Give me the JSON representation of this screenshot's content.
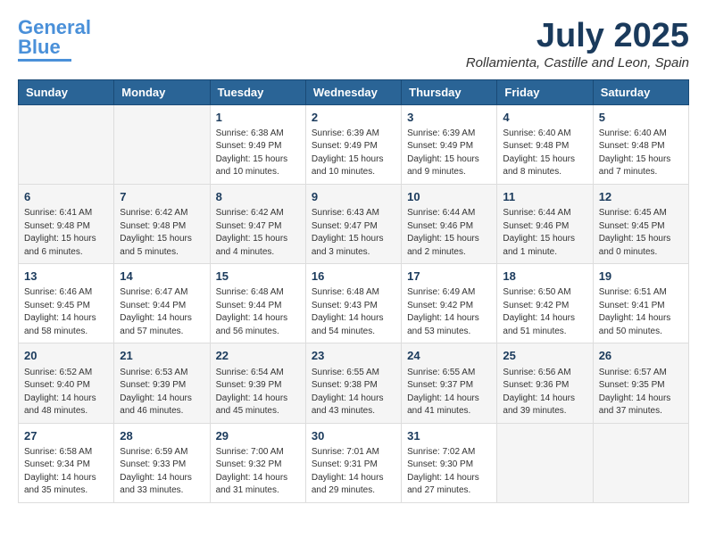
{
  "header": {
    "logo_line1": "General",
    "logo_line2": "Blue",
    "month": "July 2025",
    "location": "Rollamienta, Castille and Leon, Spain"
  },
  "days_of_week": [
    "Sunday",
    "Monday",
    "Tuesday",
    "Wednesday",
    "Thursday",
    "Friday",
    "Saturday"
  ],
  "weeks": [
    [
      {
        "day": "",
        "sunrise": "",
        "sunset": "",
        "daylight": ""
      },
      {
        "day": "",
        "sunrise": "",
        "sunset": "",
        "daylight": ""
      },
      {
        "day": "1",
        "sunrise": "Sunrise: 6:38 AM",
        "sunset": "Sunset: 9:49 PM",
        "daylight": "Daylight: 15 hours and 10 minutes."
      },
      {
        "day": "2",
        "sunrise": "Sunrise: 6:39 AM",
        "sunset": "Sunset: 9:49 PM",
        "daylight": "Daylight: 15 hours and 10 minutes."
      },
      {
        "day": "3",
        "sunrise": "Sunrise: 6:39 AM",
        "sunset": "Sunset: 9:49 PM",
        "daylight": "Daylight: 15 hours and 9 minutes."
      },
      {
        "day": "4",
        "sunrise": "Sunrise: 6:40 AM",
        "sunset": "Sunset: 9:48 PM",
        "daylight": "Daylight: 15 hours and 8 minutes."
      },
      {
        "day": "5",
        "sunrise": "Sunrise: 6:40 AM",
        "sunset": "Sunset: 9:48 PM",
        "daylight": "Daylight: 15 hours and 7 minutes."
      }
    ],
    [
      {
        "day": "6",
        "sunrise": "Sunrise: 6:41 AM",
        "sunset": "Sunset: 9:48 PM",
        "daylight": "Daylight: 15 hours and 6 minutes."
      },
      {
        "day": "7",
        "sunrise": "Sunrise: 6:42 AM",
        "sunset": "Sunset: 9:48 PM",
        "daylight": "Daylight: 15 hours and 5 minutes."
      },
      {
        "day": "8",
        "sunrise": "Sunrise: 6:42 AM",
        "sunset": "Sunset: 9:47 PM",
        "daylight": "Daylight: 15 hours and 4 minutes."
      },
      {
        "day": "9",
        "sunrise": "Sunrise: 6:43 AM",
        "sunset": "Sunset: 9:47 PM",
        "daylight": "Daylight: 15 hours and 3 minutes."
      },
      {
        "day": "10",
        "sunrise": "Sunrise: 6:44 AM",
        "sunset": "Sunset: 9:46 PM",
        "daylight": "Daylight: 15 hours and 2 minutes."
      },
      {
        "day": "11",
        "sunrise": "Sunrise: 6:44 AM",
        "sunset": "Sunset: 9:46 PM",
        "daylight": "Daylight: 15 hours and 1 minute."
      },
      {
        "day": "12",
        "sunrise": "Sunrise: 6:45 AM",
        "sunset": "Sunset: 9:45 PM",
        "daylight": "Daylight: 15 hours and 0 minutes."
      }
    ],
    [
      {
        "day": "13",
        "sunrise": "Sunrise: 6:46 AM",
        "sunset": "Sunset: 9:45 PM",
        "daylight": "Daylight: 14 hours and 58 minutes."
      },
      {
        "day": "14",
        "sunrise": "Sunrise: 6:47 AM",
        "sunset": "Sunset: 9:44 PM",
        "daylight": "Daylight: 14 hours and 57 minutes."
      },
      {
        "day": "15",
        "sunrise": "Sunrise: 6:48 AM",
        "sunset": "Sunset: 9:44 PM",
        "daylight": "Daylight: 14 hours and 56 minutes."
      },
      {
        "day": "16",
        "sunrise": "Sunrise: 6:48 AM",
        "sunset": "Sunset: 9:43 PM",
        "daylight": "Daylight: 14 hours and 54 minutes."
      },
      {
        "day": "17",
        "sunrise": "Sunrise: 6:49 AM",
        "sunset": "Sunset: 9:42 PM",
        "daylight": "Daylight: 14 hours and 53 minutes."
      },
      {
        "day": "18",
        "sunrise": "Sunrise: 6:50 AM",
        "sunset": "Sunset: 9:42 PM",
        "daylight": "Daylight: 14 hours and 51 minutes."
      },
      {
        "day": "19",
        "sunrise": "Sunrise: 6:51 AM",
        "sunset": "Sunset: 9:41 PM",
        "daylight": "Daylight: 14 hours and 50 minutes."
      }
    ],
    [
      {
        "day": "20",
        "sunrise": "Sunrise: 6:52 AM",
        "sunset": "Sunset: 9:40 PM",
        "daylight": "Daylight: 14 hours and 48 minutes."
      },
      {
        "day": "21",
        "sunrise": "Sunrise: 6:53 AM",
        "sunset": "Sunset: 9:39 PM",
        "daylight": "Daylight: 14 hours and 46 minutes."
      },
      {
        "day": "22",
        "sunrise": "Sunrise: 6:54 AM",
        "sunset": "Sunset: 9:39 PM",
        "daylight": "Daylight: 14 hours and 45 minutes."
      },
      {
        "day": "23",
        "sunrise": "Sunrise: 6:55 AM",
        "sunset": "Sunset: 9:38 PM",
        "daylight": "Daylight: 14 hours and 43 minutes."
      },
      {
        "day": "24",
        "sunrise": "Sunrise: 6:55 AM",
        "sunset": "Sunset: 9:37 PM",
        "daylight": "Daylight: 14 hours and 41 minutes."
      },
      {
        "day": "25",
        "sunrise": "Sunrise: 6:56 AM",
        "sunset": "Sunset: 9:36 PM",
        "daylight": "Daylight: 14 hours and 39 minutes."
      },
      {
        "day": "26",
        "sunrise": "Sunrise: 6:57 AM",
        "sunset": "Sunset: 9:35 PM",
        "daylight": "Daylight: 14 hours and 37 minutes."
      }
    ],
    [
      {
        "day": "27",
        "sunrise": "Sunrise: 6:58 AM",
        "sunset": "Sunset: 9:34 PM",
        "daylight": "Daylight: 14 hours and 35 minutes."
      },
      {
        "day": "28",
        "sunrise": "Sunrise: 6:59 AM",
        "sunset": "Sunset: 9:33 PM",
        "daylight": "Daylight: 14 hours and 33 minutes."
      },
      {
        "day": "29",
        "sunrise": "Sunrise: 7:00 AM",
        "sunset": "Sunset: 9:32 PM",
        "daylight": "Daylight: 14 hours and 31 minutes."
      },
      {
        "day": "30",
        "sunrise": "Sunrise: 7:01 AM",
        "sunset": "Sunset: 9:31 PM",
        "daylight": "Daylight: 14 hours and 29 minutes."
      },
      {
        "day": "31",
        "sunrise": "Sunrise: 7:02 AM",
        "sunset": "Sunset: 9:30 PM",
        "daylight": "Daylight: 14 hours and 27 minutes."
      },
      {
        "day": "",
        "sunrise": "",
        "sunset": "",
        "daylight": ""
      },
      {
        "day": "",
        "sunrise": "",
        "sunset": "",
        "daylight": ""
      }
    ]
  ]
}
